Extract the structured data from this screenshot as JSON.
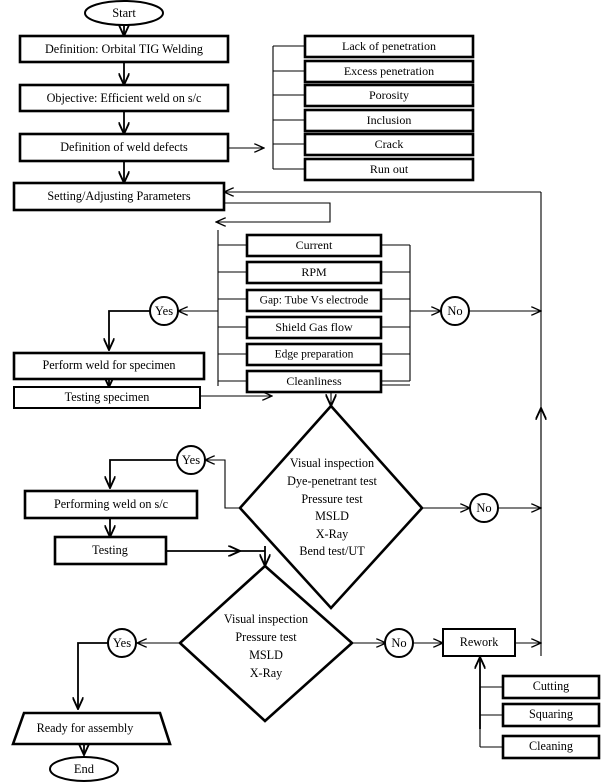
{
  "diagram": {
    "title": "Orbital TIG Welding Process Flowchart",
    "type": "flowchart",
    "colors": {
      "stroke": "#000000",
      "fill": "#ffffff",
      "text": "#000000"
    }
  },
  "terminators": {
    "start": "Start",
    "end": "End"
  },
  "main_steps": {
    "definition": "Definition: Orbital TIG Welding",
    "objective": "Objective: Efficient weld on s/c",
    "defects": "Definition of weld defects",
    "setting": "Setting/Adjusting Parameters",
    "perform_weld_specimen": "Perform weld for specimen",
    "testing_specimen": "Testing specimen",
    "performing_weld_sc": "Performing weld on s/c",
    "testing": "Testing",
    "rework": "Rework",
    "ready": "Ready for assembly"
  },
  "weld_defects": [
    "Lack of penetration",
    "Excess penetration",
    "Porosity",
    "Inclusion",
    "Crack",
    "Run out"
  ],
  "parameters": [
    "Current",
    "RPM",
    "Gap: Tube Vs electrode",
    "Shield Gas flow",
    "Edge preparation",
    "Cleanliness"
  ],
  "rework_ops": [
    "Cutting",
    "Squaring",
    "Cleaning"
  ],
  "decision_specimen": {
    "lines": [
      "Visual inspection",
      "Dye-penetrant test",
      "Pressure test",
      "MSLD",
      "X-Ray",
      "Bend test/UT"
    ]
  },
  "decision_sc": {
    "lines": [
      "Visual inspection",
      "Pressure test",
      "MSLD",
      "X-Ray"
    ]
  },
  "branch_labels": {
    "yes_param": "Yes",
    "no_param": "No",
    "yes_specimen": "Yes",
    "no_specimen": "No",
    "yes_sc": "Yes",
    "no_sc": "No"
  }
}
